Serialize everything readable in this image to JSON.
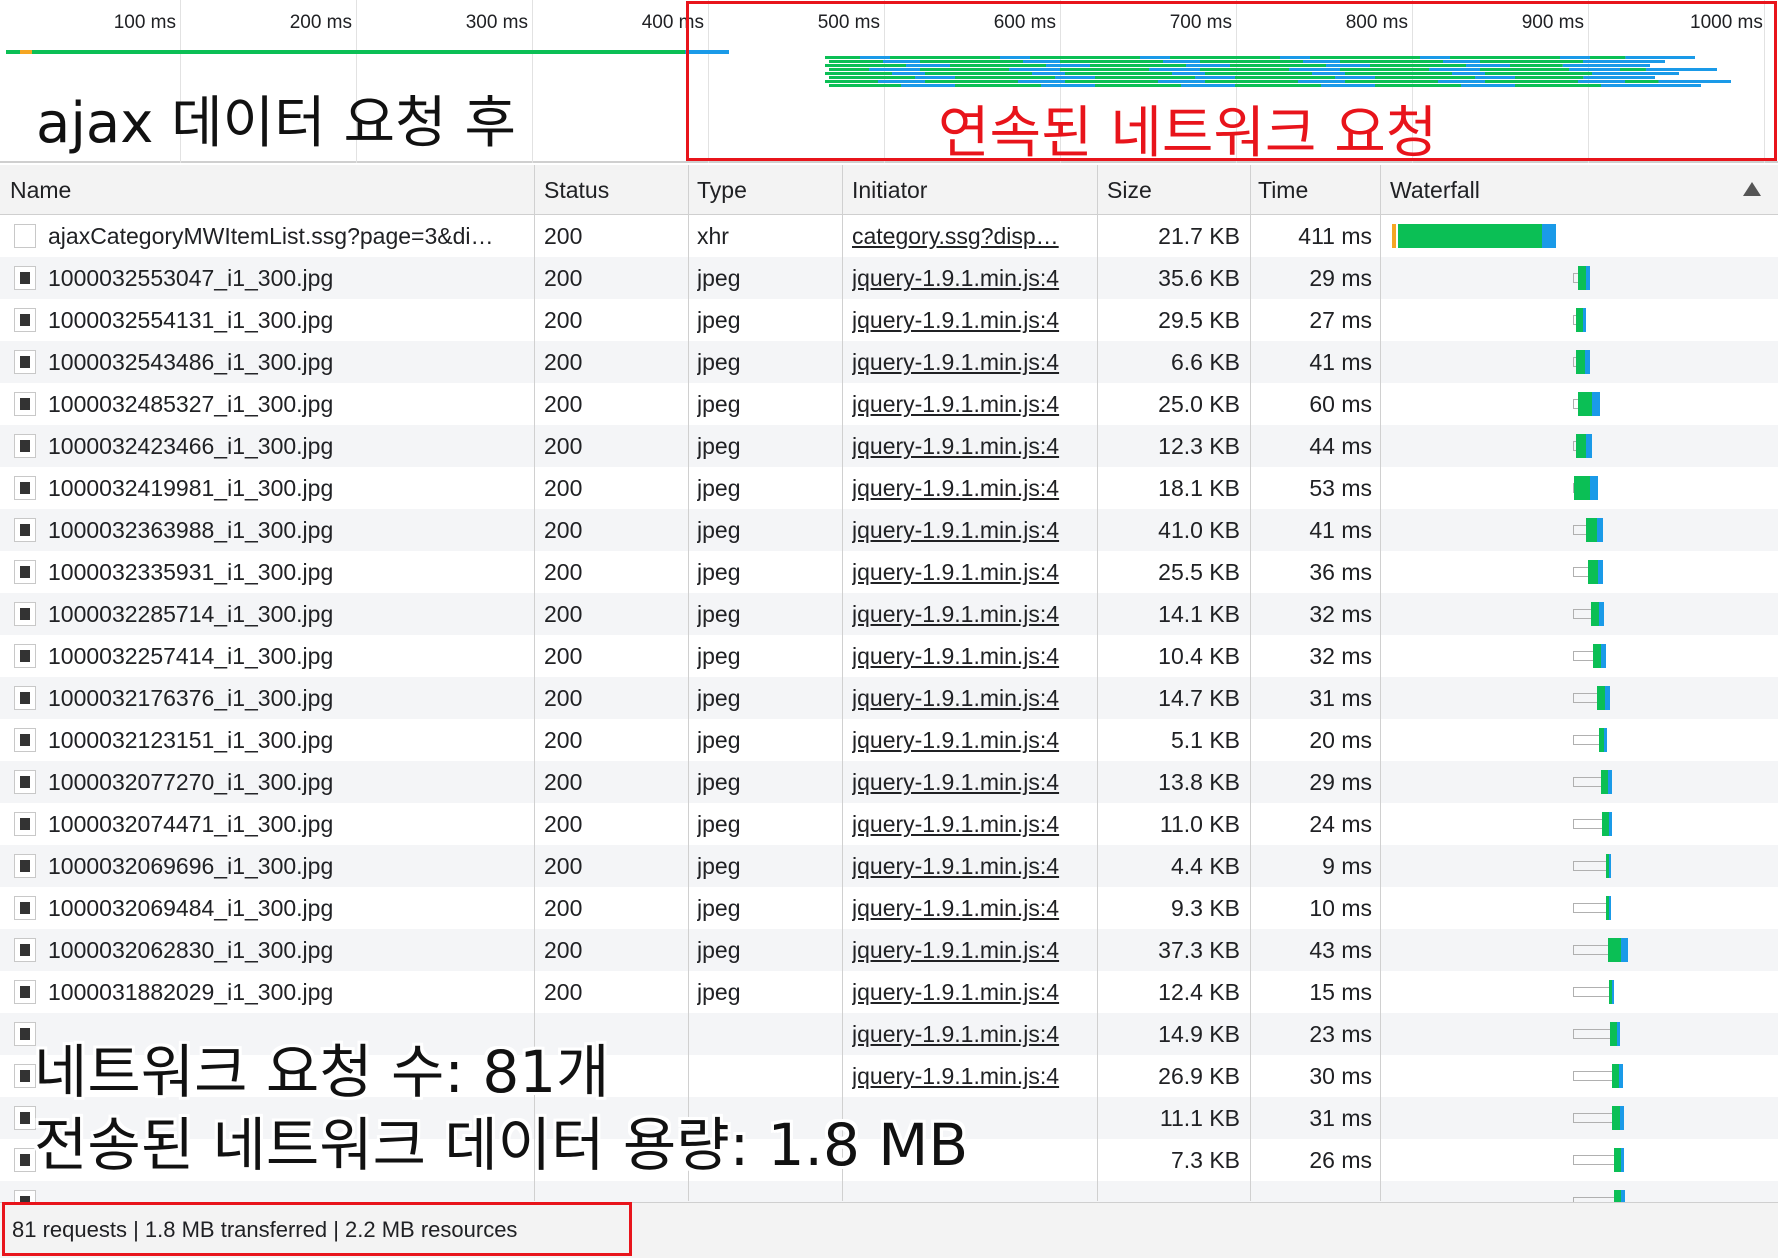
{
  "overview": {
    "ticks": [
      "100 ms",
      "200 ms",
      "300 ms",
      "400 ms",
      "500 ms",
      "600 ms",
      "700 ms",
      "800 ms",
      "900 ms",
      "1000 ms"
    ],
    "annotation_left": "ajax 데이터 요청 후",
    "annotation_right": "연속된 네트워크 요청"
  },
  "table": {
    "columns": [
      "Name",
      "Status",
      "Type",
      "Initiator",
      "Size",
      "Time",
      "Waterfall"
    ],
    "rows": [
      {
        "name": "ajaxCategoryMWItemList.ssg?page=3&di…",
        "status": "200",
        "type": "xhr",
        "initiator": "category.ssg?disp…",
        "size": "21.7 KB",
        "time": "411 ms"
      },
      {
        "name": "1000032553047_i1_300.jpg",
        "status": "200",
        "type": "jpeg",
        "initiator": "jquery-1.9.1.min.js:4",
        "size": "35.6 KB",
        "time": "29 ms"
      },
      {
        "name": "1000032554131_i1_300.jpg",
        "status": "200",
        "type": "jpeg",
        "initiator": "jquery-1.9.1.min.js:4",
        "size": "29.5 KB",
        "time": "27 ms"
      },
      {
        "name": "1000032543486_i1_300.jpg",
        "status": "200",
        "type": "jpeg",
        "initiator": "jquery-1.9.1.min.js:4",
        "size": "6.6 KB",
        "time": "41 ms"
      },
      {
        "name": "1000032485327_i1_300.jpg",
        "status": "200",
        "type": "jpeg",
        "initiator": "jquery-1.9.1.min.js:4",
        "size": "25.0 KB",
        "time": "60 ms"
      },
      {
        "name": "1000032423466_i1_300.jpg",
        "status": "200",
        "type": "jpeg",
        "initiator": "jquery-1.9.1.min.js:4",
        "size": "12.3 KB",
        "time": "44 ms"
      },
      {
        "name": "1000032419981_i1_300.jpg",
        "status": "200",
        "type": "jpeg",
        "initiator": "jquery-1.9.1.min.js:4",
        "size": "18.1 KB",
        "time": "53 ms"
      },
      {
        "name": "1000032363988_i1_300.jpg",
        "status": "200",
        "type": "jpeg",
        "initiator": "jquery-1.9.1.min.js:4",
        "size": "41.0 KB",
        "time": "41 ms"
      },
      {
        "name": "1000032335931_i1_300.jpg",
        "status": "200",
        "type": "jpeg",
        "initiator": "jquery-1.9.1.min.js:4",
        "size": "25.5 KB",
        "time": "36 ms"
      },
      {
        "name": "1000032285714_i1_300.jpg",
        "status": "200",
        "type": "jpeg",
        "initiator": "jquery-1.9.1.min.js:4",
        "size": "14.1 KB",
        "time": "32 ms"
      },
      {
        "name": "1000032257414_i1_300.jpg",
        "status": "200",
        "type": "jpeg",
        "initiator": "jquery-1.9.1.min.js:4",
        "size": "10.4 KB",
        "time": "32 ms"
      },
      {
        "name": "1000032176376_i1_300.jpg",
        "status": "200",
        "type": "jpeg",
        "initiator": "jquery-1.9.1.min.js:4",
        "size": "14.7 KB",
        "time": "31 ms"
      },
      {
        "name": "1000032123151_i1_300.jpg",
        "status": "200",
        "type": "jpeg",
        "initiator": "jquery-1.9.1.min.js:4",
        "size": "5.1 KB",
        "time": "20 ms"
      },
      {
        "name": "1000032077270_i1_300.jpg",
        "status": "200",
        "type": "jpeg",
        "initiator": "jquery-1.9.1.min.js:4",
        "size": "13.8 KB",
        "time": "29 ms"
      },
      {
        "name": "1000032074471_i1_300.jpg",
        "status": "200",
        "type": "jpeg",
        "initiator": "jquery-1.9.1.min.js:4",
        "size": "11.0 KB",
        "time": "24 ms"
      },
      {
        "name": "1000032069696_i1_300.jpg",
        "status": "200",
        "type": "jpeg",
        "initiator": "jquery-1.9.1.min.js:4",
        "size": "4.4 KB",
        "time": "9 ms"
      },
      {
        "name": "1000032069484_i1_300.jpg",
        "status": "200",
        "type": "jpeg",
        "initiator": "jquery-1.9.1.min.js:4",
        "size": "9.3 KB",
        "time": "10 ms"
      },
      {
        "name": "1000032062830_i1_300.jpg",
        "status": "200",
        "type": "jpeg",
        "initiator": "jquery-1.9.1.min.js:4",
        "size": "37.3 KB",
        "time": "43 ms"
      },
      {
        "name": "1000031882029_i1_300.jpg",
        "status": "200",
        "type": "jpeg",
        "initiator": "jquery-1.9.1.min.js:4",
        "size": "12.4 KB",
        "time": "15 ms"
      },
      {
        "name": "",
        "status": "",
        "type": "",
        "initiator": "jquery-1.9.1.min.js:4",
        "size": "14.9 KB",
        "time": "23 ms"
      },
      {
        "name": "",
        "status": "",
        "type": "",
        "initiator": "jquery-1.9.1.min.js:4",
        "size": "26.9 KB",
        "time": "30 ms"
      },
      {
        "name": "",
        "status": "",
        "type": "",
        "initiator": "",
        "size": "11.1 KB",
        "time": "31 ms"
      },
      {
        "name": "",
        "status": "",
        "type": "",
        "initiator": "",
        "size": "7.3 KB",
        "time": "26 ms"
      },
      {
        "name": "",
        "status": "",
        "type": "",
        "initiator": "",
        "size": "",
        "time": ""
      }
    ]
  },
  "overlay": {
    "line1": "네트워크 요청 수: 81개",
    "line2": "전송된 네트워크 데이터 용량: 1.8 MB"
  },
  "status_bar": {
    "summary": "81 requests | 1.8 MB transferred | 2.2 MB resources"
  },
  "colors": {
    "waiting": "#f5a623",
    "download_green": "#0bbf55",
    "receive_blue": "#1a9ae8",
    "annotation_red": "#e8141b"
  }
}
